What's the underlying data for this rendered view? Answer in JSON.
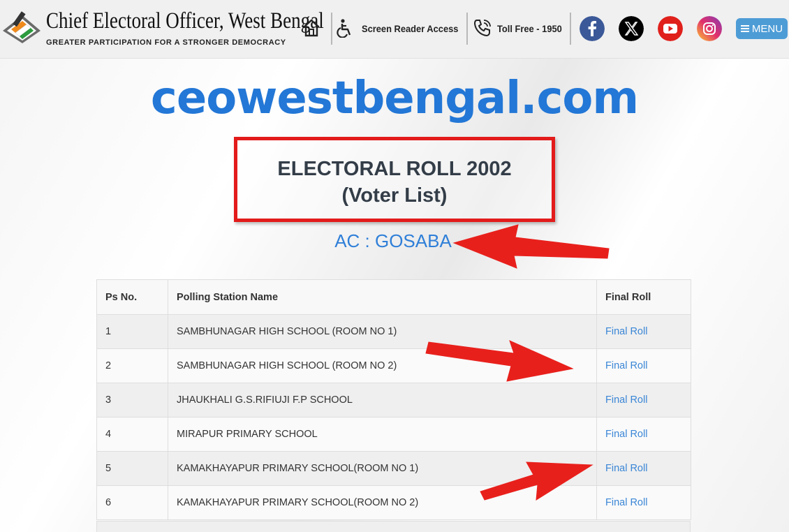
{
  "header": {
    "logo_title": "Chief Electoral Officer, West Bengal",
    "logo_tagline": "GREATER PARTICIPATION FOR A STRONGER DEMOCRACY",
    "screen_reader_label": "Screen Reader Access",
    "toll_free_label": "Toll Free - 1950",
    "menu_label": "MENU",
    "social": [
      {
        "icon": "facebook-icon",
        "color": "#3b5998"
      },
      {
        "icon": "x-twitter-icon",
        "color": "#000000"
      },
      {
        "icon": "youtube-icon",
        "color": "#e0201b"
      },
      {
        "icon": "instagram-icon",
        "color": "#d6249f"
      }
    ]
  },
  "watermark": "ceowestbengal.com",
  "page": {
    "title_line1": "ELECTORAL ROLL 2002",
    "title_line2": "(Voter List)",
    "ac_label": "AC : GOSABA"
  },
  "table": {
    "headers": [
      "Ps No.",
      "Polling Station Name",
      "Final Roll"
    ],
    "rows": [
      {
        "ps_no": "1",
        "name": "SAMBHUNAGAR HIGH SCHOOL (ROOM NO 1)",
        "link": "Final Roll"
      },
      {
        "ps_no": "2",
        "name": "SAMBHUNAGAR HIGH SCHOOL (ROOM NO 2)",
        "link": "Final Roll"
      },
      {
        "ps_no": "3",
        "name": "JHAUKHALI G.S.RIFIUJI F.P SCHOOL",
        "link": "Final Roll"
      },
      {
        "ps_no": "4",
        "name": "MIRAPUR PRIMARY SCHOOL",
        "link": "Final Roll"
      },
      {
        "ps_no": "5",
        "name": "KAMAKHAYAPUR PRIMARY SCHOOL(ROOM NO 1)",
        "link": "Final Roll"
      },
      {
        "ps_no": "6",
        "name": "KAMAKHAYAPUR PRIMARY SCHOOL(ROOM NO 2)",
        "link": "Final Roll"
      }
    ]
  },
  "colors": {
    "accent": "#2f7fd8",
    "highlight_red": "#e31b1b",
    "menu_button": "#4d9cd6"
  }
}
